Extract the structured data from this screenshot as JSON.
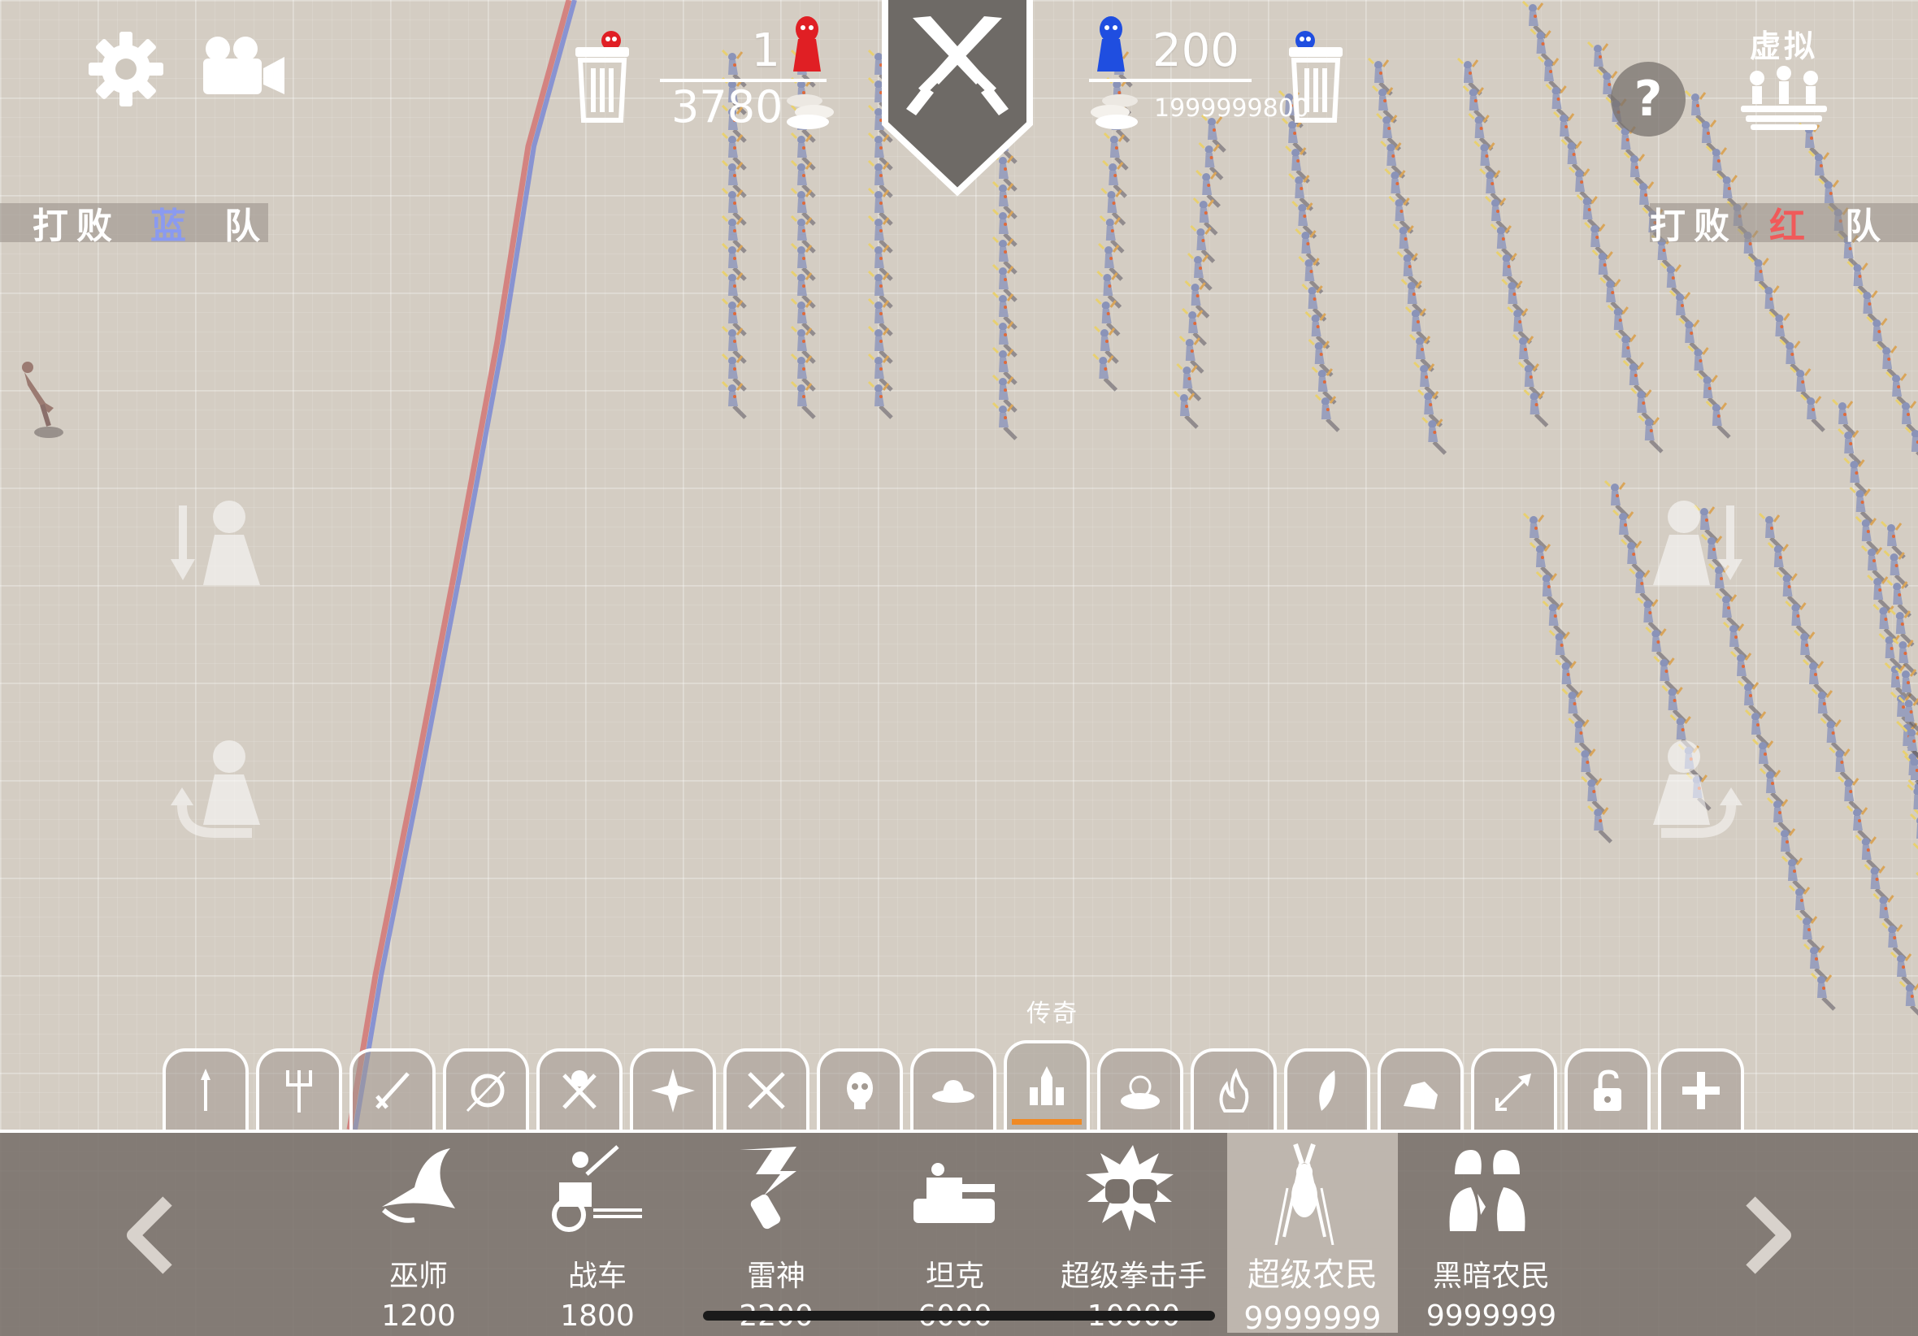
{
  "top": {
    "settings_icon": "gear-icon",
    "camera_icon": "video-camera-icon",
    "help_label": "?",
    "virtual_label": "虚拟"
  },
  "red_team": {
    "unit_count": "1",
    "gold": "3780",
    "color": "#e01f24",
    "banner": [
      "打",
      "败",
      "蓝",
      "队"
    ],
    "banner_highlight_color": "#8a9af0"
  },
  "blue_team": {
    "unit_count": "200",
    "gold": "1999999800",
    "color": "#1f4ee0",
    "banner": [
      "打",
      "败",
      "红",
      "队"
    ],
    "banner_highlight_color": "#f05a5a"
  },
  "category_label": "传奇",
  "categories": [
    {
      "name": "spear-icon"
    },
    {
      "name": "pitchfork-icon"
    },
    {
      "name": "sword-icon"
    },
    {
      "name": "shield-icon"
    },
    {
      "name": "viking-helmet-icon"
    },
    {
      "name": "shuriken-icon"
    },
    {
      "name": "crossed-swords-icon"
    },
    {
      "name": "skull-icon"
    },
    {
      "name": "cowboy-hat-icon"
    },
    {
      "name": "castle-icon",
      "active": true
    },
    {
      "name": "sun-cloud-icon"
    },
    {
      "name": "fire-icon"
    },
    {
      "name": "feather-icon"
    },
    {
      "name": "rock-icon"
    },
    {
      "name": "arrow-icon"
    },
    {
      "name": "unlock-icon"
    },
    {
      "name": "plus-icon"
    }
  ],
  "units": [
    {
      "name": "巫师",
      "cost": "1200",
      "icon": "wizard-hat-icon"
    },
    {
      "name": "战车",
      "cost": "1800",
      "icon": "chariot-icon"
    },
    {
      "name": "雷神",
      "cost": "2200",
      "icon": "thunder-god-icon"
    },
    {
      "name": "坦克",
      "cost": "6000",
      "icon": "tank-icon"
    },
    {
      "name": "超级拳击手",
      "cost": "10000",
      "icon": "boxing-gloves-icon"
    },
    {
      "name": "超级农民",
      "cost": "9999999",
      "icon": "super-peasant-icon",
      "selected": true
    },
    {
      "name": "黑暗农民",
      "cost": "9999999",
      "icon": "dark-peasant-hands-icon"
    }
  ]
}
